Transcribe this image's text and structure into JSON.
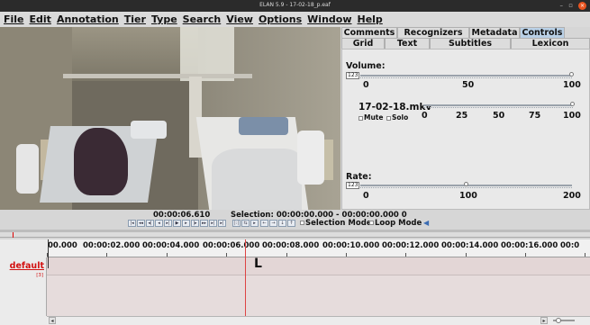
{
  "window": {
    "title": "ELAN 5.9 - 17-02-18_p.eaf",
    "minimize_glyph": "–",
    "maximize_glyph": "▫",
    "close_glyph": "×"
  },
  "menubar": {
    "items": [
      "File",
      "Edit",
      "Annotation",
      "Tier",
      "Type",
      "Search",
      "View",
      "Options",
      "Window",
      "Help"
    ]
  },
  "panel": {
    "tabs_row1": [
      "Comments",
      "Recognizers",
      "Metadata",
      "Controls"
    ],
    "active_tab": "Controls",
    "tabs_row2": [
      "Grid",
      "Text",
      "Subtitles",
      "Lexicon"
    ],
    "volume": {
      "label": "Volume:",
      "icon": "123",
      "value": 1.0,
      "min_label": "0",
      "mid_label": "50",
      "max_label": "100"
    },
    "media": {
      "file_label": "17-02-18.mkv",
      "value": 1.0,
      "mute_label": "Mute",
      "solo_label": "Solo",
      "scale_labels": [
        "0",
        "25",
        "50",
        "75",
        "100"
      ]
    },
    "rate": {
      "label": "Rate:",
      "icon": "123",
      "value": 100,
      "min_label": "0",
      "mid_label": "100",
      "max_label": "200"
    }
  },
  "status": {
    "current_time": "00:00:06.610",
    "selection": "Selection: 00:00:00.000 - 00:00:00.000 0",
    "selection_mode": "Selection Mode",
    "loop_mode": "Loop Mode"
  },
  "timeline": {
    "tick_labels": [
      "00.000",
      "00:00:02.000",
      "00:00:04.000",
      "00:00:06.000",
      "00:00:08.000",
      "00:00:10.000",
      "00:00:12.000",
      "00:00:14.000",
      "00:00:16.000",
      "00:0"
    ],
    "tier_name": "default",
    "tier_count": "[3]"
  },
  "colors": {
    "accent": "#b9d0e6",
    "tier_label": "#d21010",
    "crosshair": "#dd4444",
    "titlebar": "#2b2b2b",
    "close_button": "#e95420"
  }
}
